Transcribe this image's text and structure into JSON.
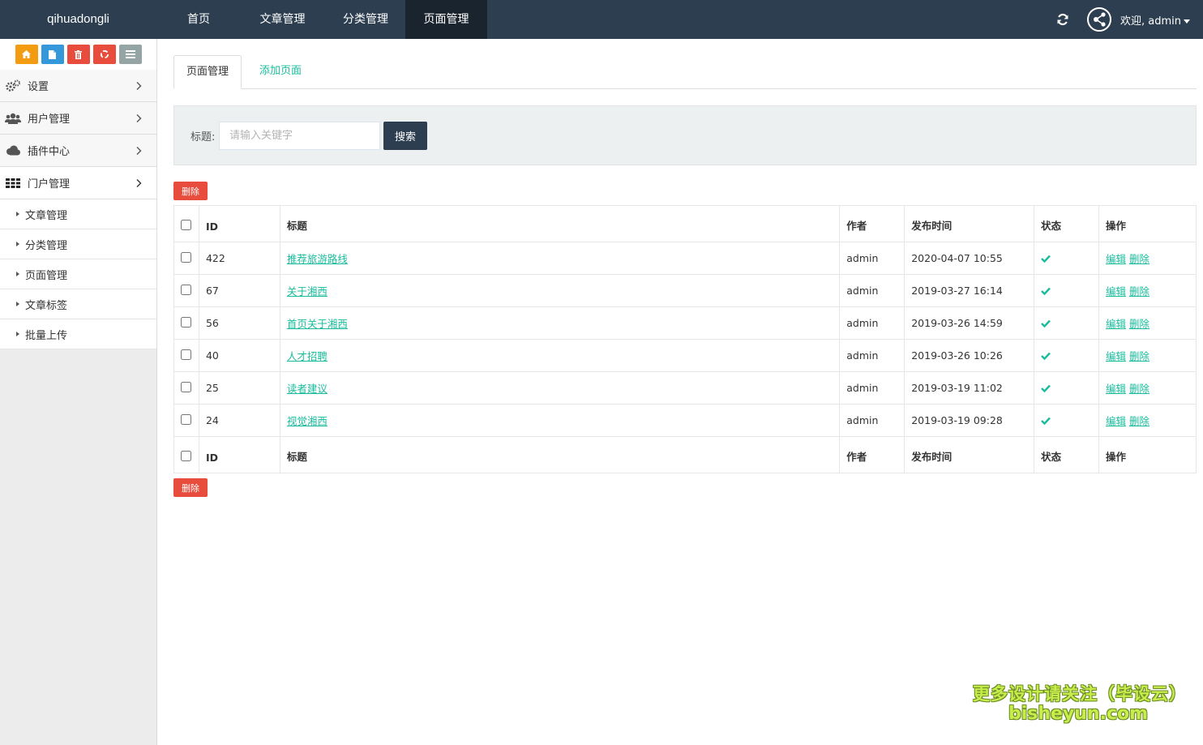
{
  "navbar": {
    "brand": "qihuadongli",
    "items": [
      {
        "label": "首页"
      },
      {
        "label": "文章管理"
      },
      {
        "label": "分类管理"
      },
      {
        "label": "页面管理"
      }
    ],
    "active_index": 3,
    "welcome": "欢迎, admin"
  },
  "sidebar": {
    "shortcuts": [
      {
        "icon": "home-icon",
        "color": "#f39c12"
      },
      {
        "icon": "file-icon",
        "color": "#3498db"
      },
      {
        "icon": "trash-icon",
        "color": "#e74c3c"
      },
      {
        "icon": "recycle-icon",
        "color": "#e74c3c"
      },
      {
        "icon": "list-icon",
        "color": "#95a5a6"
      }
    ],
    "menu": [
      {
        "label": "设置",
        "icon": "gears-icon"
      },
      {
        "label": "用户管理",
        "icon": "users-icon"
      },
      {
        "label": "插件中心",
        "icon": "cloud-icon"
      },
      {
        "label": "门户管理",
        "icon": "grid-icon"
      }
    ],
    "submenu": [
      {
        "label": "文章管理"
      },
      {
        "label": "分类管理"
      },
      {
        "label": "页面管理"
      },
      {
        "label": "文章标签"
      },
      {
        "label": "批量上传"
      }
    ]
  },
  "tabs": {
    "active": "页面管理",
    "add": "添加页面"
  },
  "search": {
    "label": "标题:",
    "placeholder": "请输入关键字",
    "button": "搜索"
  },
  "delete_label": "删除",
  "table": {
    "columns": [
      "ID",
      "标题",
      "作者",
      "发布时间",
      "状态",
      "操作"
    ],
    "rows": [
      {
        "id": "422",
        "title": "推荐旅游路线",
        "author": "admin",
        "date": "2020-04-07 10:55",
        "edit": "编辑",
        "delete": "删除"
      },
      {
        "id": "67",
        "title": "关于湘西",
        "author": "admin",
        "date": "2019-03-27 16:14",
        "edit": "编辑",
        "delete": "删除"
      },
      {
        "id": "56",
        "title": "首页关于湘西",
        "author": "admin",
        "date": "2019-03-26 14:59",
        "edit": "编辑",
        "delete": "删除"
      },
      {
        "id": "40",
        "title": "人才招聘",
        "author": "admin",
        "date": "2019-03-26 10:26",
        "edit": "编辑",
        "delete": "删除"
      },
      {
        "id": "25",
        "title": "读者建议",
        "author": "admin",
        "date": "2019-03-19 11:02",
        "edit": "编辑",
        "delete": "删除"
      },
      {
        "id": "24",
        "title": "视觉湘西",
        "author": "admin",
        "date": "2019-03-19 09:28",
        "edit": "编辑",
        "delete": "删除"
      }
    ],
    "status_color": "#18bc9c"
  },
  "watermark": {
    "line1": "更多设计请关注（毕设云）",
    "line2": "bisheyun.com"
  },
  "colors": {
    "navbar": "#2c3e50",
    "accent": "#18bc9c",
    "danger": "#e74c3c"
  }
}
